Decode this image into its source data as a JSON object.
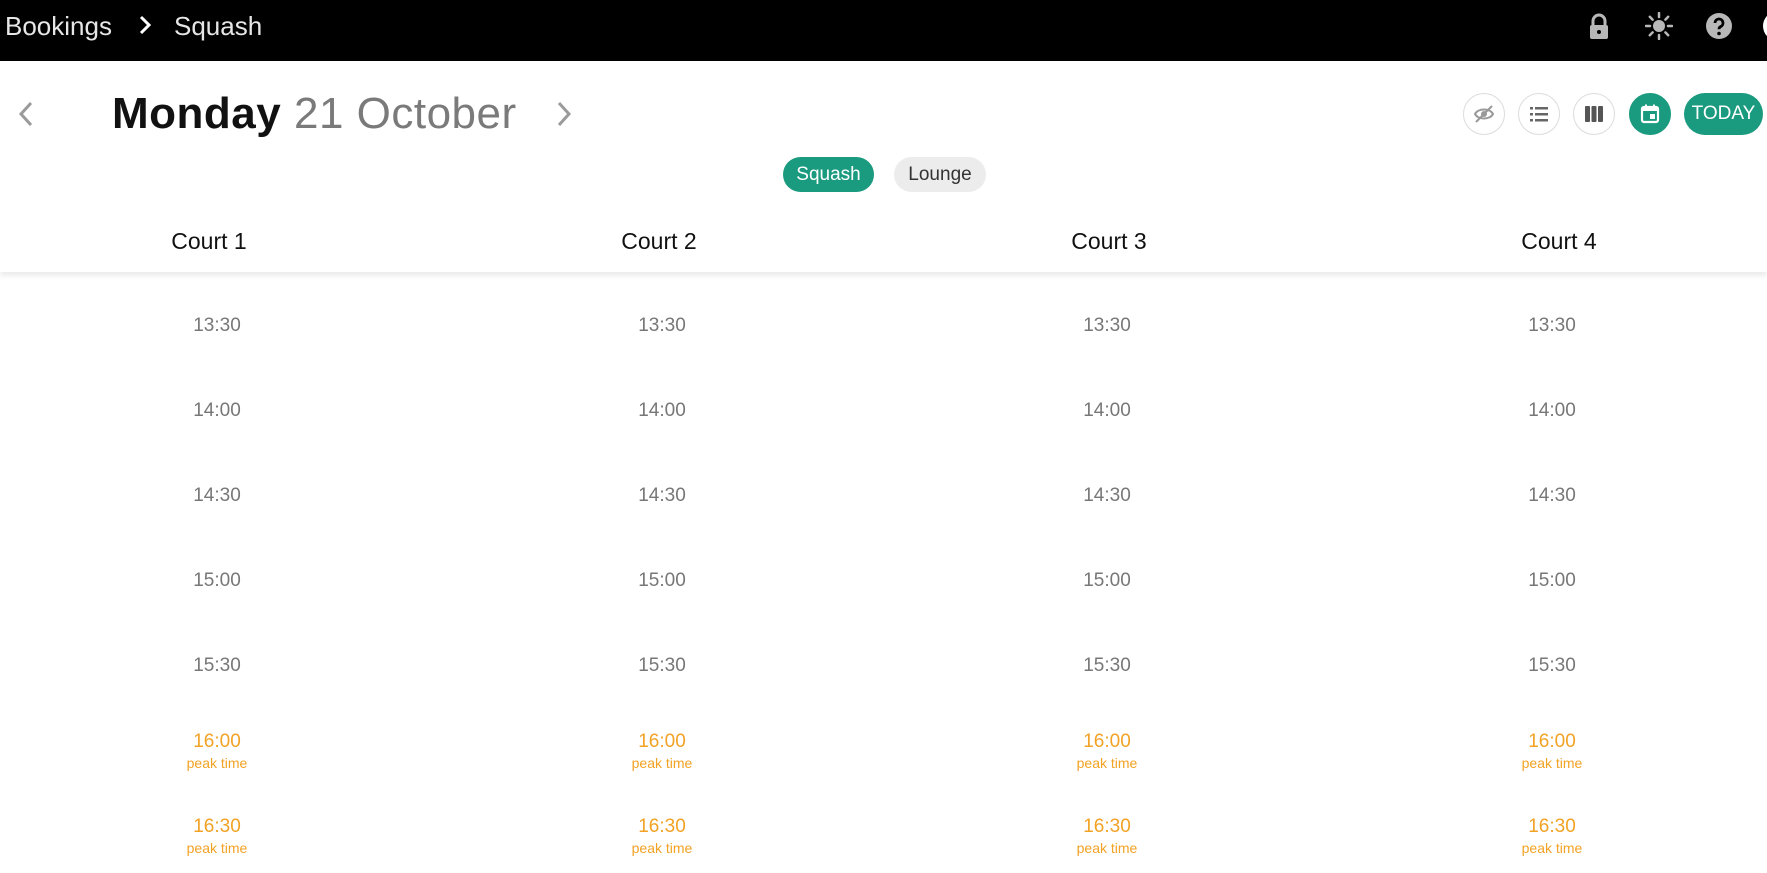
{
  "header": {
    "breadcrumb": [
      "Bookings",
      "Squash"
    ],
    "icons": [
      "lock-icon",
      "theme-sun-icon",
      "help-icon",
      "avatar"
    ]
  },
  "date_nav": {
    "day": "Monday",
    "date": "21 October"
  },
  "view_toolbar": {
    "buttons": [
      "hide-icon",
      "list-view-icon",
      "columns-view-icon",
      "calendar-icon"
    ],
    "active": "calendar-icon",
    "today_label": "TODAY"
  },
  "filters": [
    {
      "label": "Squash",
      "active": true
    },
    {
      "label": "Lounge",
      "active": false
    }
  ],
  "courts": [
    {
      "name": "Court 1"
    },
    {
      "name": "Court 2"
    },
    {
      "name": "Court 3"
    },
    {
      "name": "Court 4"
    }
  ],
  "slots": [
    {
      "time": "13:30",
      "note": ""
    },
    {
      "time": "14:00",
      "note": ""
    },
    {
      "time": "14:30",
      "note": ""
    },
    {
      "time": "15:00",
      "note": ""
    },
    {
      "time": "15:30",
      "note": ""
    },
    {
      "time": "16:00",
      "note": "peak time"
    },
    {
      "time": "16:30",
      "note": "peak time"
    }
  ],
  "colors": {
    "accent": "#1a9a7f",
    "peak": "#f2a224",
    "topbar": "#000000"
  }
}
